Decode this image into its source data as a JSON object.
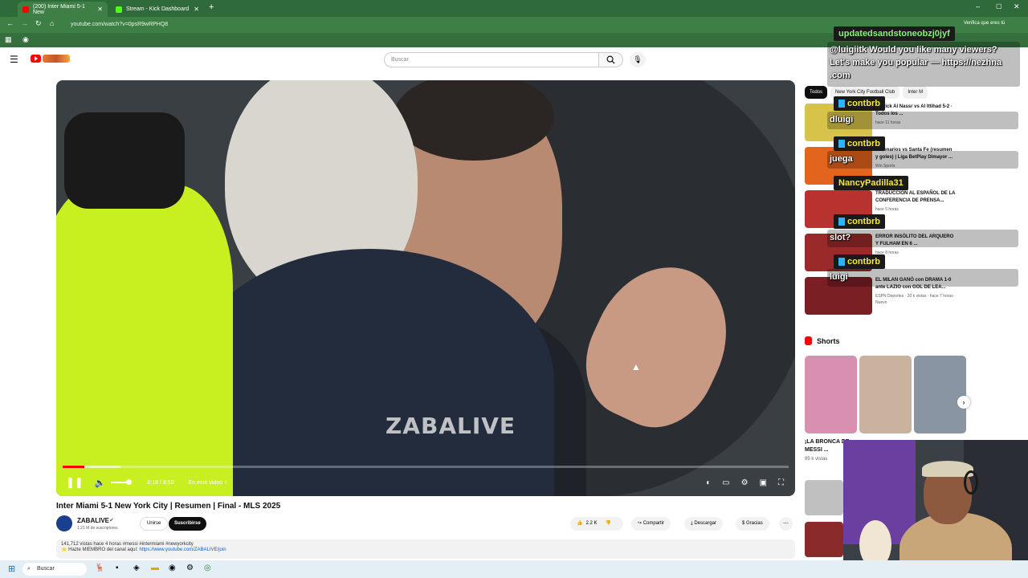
{
  "browser": {
    "tabs": [
      {
        "label": "(200) Inter Miami 5-1 New",
        "active": true,
        "fav_color": "#ff0000"
      },
      {
        "label": "Stream - Kick Dashboard",
        "active": false,
        "fav_color": "#53fc18"
      }
    ],
    "address": "youtube.com/watch?v=0psR9wRPHQ8",
    "verify_label": "Verifica que eres tú"
  },
  "youtube": {
    "search_placeholder": "Buscar"
  },
  "video": {
    "watermark": "ZABALIVE",
    "time": "0:16 / 8:50",
    "chapter_label": "En este video",
    "progress_fraction": 0.03,
    "buffered_fraction": 0.08
  },
  "details": {
    "title": "Inter Miami 5-1 New York City | Resumen | Final - MLS 2025",
    "channel": "ZABALIVE",
    "subscribers": "1.21 M de suscriptores",
    "join_label": "Unirse",
    "subscribe_label": "Suscribirse",
    "likes": "2.2 K",
    "share_label": "Compartir",
    "download_label": "Descargar",
    "thanks_label": "Gracias",
    "desc_line1": "141,712 vistas  hace 4 horas  #messi #intermiami #newyorkcity",
    "desc_line2_prefix": "⭐ Hazte MIEMBRO del canal aquí: ",
    "desc_link": "https://www.youtube.com/ZABALIVE/join"
  },
  "sidebar": {
    "chips": [
      "Todos",
      "New York City Football Club",
      "Inter M"
    ],
    "recs": [
      {
        "title": "... Trick  Al Nassr vs Al Ittihad 5-2 · Todos los ...",
        "meta": "hace 11 horas",
        "color": "#d8c34a"
      },
      {
        "title": "Millonarios vs Santa Fe (resumen y goles) | Liga BetPlay Dimayor ...",
        "meta": "Win Sports",
        "color": "#e3651d"
      },
      {
        "title": "TRADUCCIÓN AL ESPAÑOL DE LA CONFERENCIA DE PRENSA...",
        "meta": "hace 5 horas",
        "color": "#b8332f"
      },
      {
        "title": "ERROR INSÓLITO DEL ARQUERO Y FULHAM EN 6 ...",
        "meta": "hace 8 horas",
        "color": "#9a2a2a"
      },
      {
        "title": "EL MILAN GANÓ con DRAMA 1-0 ante LAZIO con GOL DE LEA...",
        "meta": "ESPN Deportes · 20 k vistas · hace 7 horas · Nuevo",
        "color": "#7a1f24"
      }
    ],
    "shorts_heading": "Shorts",
    "shorts": [
      {
        "title": "¡LA BRONCA DE MESSI ...",
        "views": "95 k vistas",
        "color": "#d98fb0"
      },
      {
        "title": "",
        "views": "",
        "color": "#c9b39f"
      },
      {
        "title": "",
        "views": "",
        "color": "#8a95a3"
      }
    ]
  },
  "chat": {
    "names": [
      {
        "text": "updatedsandstoneobzj0jyf",
        "color": "yellow"
      },
      {
        "text": "contbrb",
        "color": "yellow"
      },
      {
        "text": "contbrb",
        "color": "yellow"
      },
      {
        "text": "NancyPadilla31",
        "color": "yellow"
      },
      {
        "text": "contbrb",
        "color": "yellow"
      },
      {
        "text": "contbrb",
        "color": "yellow"
      }
    ],
    "messages": [
      "@luigiitk Would you like many viewers? Let's make you popular — https://nezhna .com",
      "dluigi",
      "juega",
      "slot?",
      "luigi"
    ]
  },
  "taskbar": {
    "search_label": "Buscar"
  }
}
